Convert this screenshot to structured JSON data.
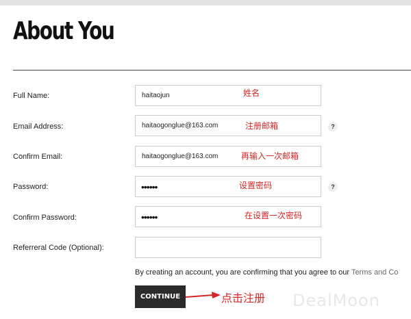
{
  "page": {
    "title": "About You"
  },
  "form": {
    "fields": [
      {
        "label": "Full Name:",
        "value": "haitaojun",
        "annotation": "姓名",
        "help": ""
      },
      {
        "label": "Email Address:",
        "value": "haitaogonglue@163.com",
        "annotation": "注册邮箱",
        "help": "?"
      },
      {
        "label": "Confirm Email:",
        "value": "haitaogonglue@163.com",
        "annotation": "再输入一次邮箱",
        "help": ""
      },
      {
        "label": "Password:",
        "value": "••••••",
        "annotation": "设置密码",
        "help": "?"
      },
      {
        "label": "Confirm Password:",
        "value": "••••••",
        "annotation": "在设置一次密码",
        "help": ""
      },
      {
        "label": "Referreral Code (Optional):",
        "value": "",
        "annotation": "",
        "help": ""
      }
    ],
    "agreement_text": "By creating an account, you are confirming that you agree to our ",
    "agreement_link": "Terms and Co",
    "continue_label": "CONTINUE",
    "continue_annotation": "点击注册"
  },
  "watermark": "DealMoon",
  "colors": {
    "annotation": "#d62525",
    "button_bg": "#2b2b2b",
    "rule": "#444444"
  }
}
